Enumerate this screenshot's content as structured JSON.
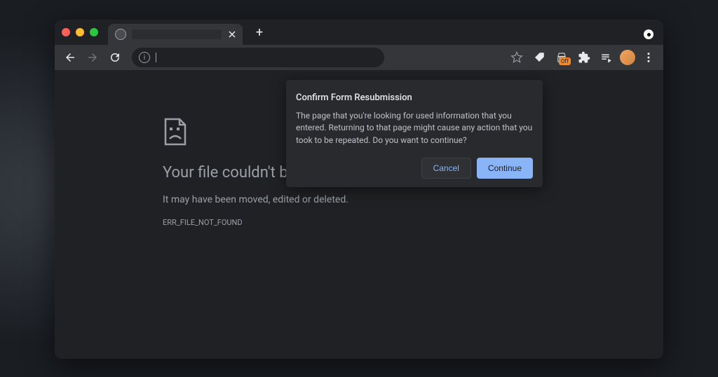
{
  "tabStrip": {
    "newTab": "+"
  },
  "toolbar": {
    "extensionBadge": "Off"
  },
  "errorPage": {
    "title": "Your file couldn't be accessed",
    "subtitle": "It may have been moved, edited or deleted.",
    "code": "ERR_FILE_NOT_FOUND"
  },
  "dialog": {
    "title": "Confirm Form Resubmission",
    "body": "The page that you're looking for used information that you entered. Returning to that page might cause any action that you took to be repeated. Do you want to continue?",
    "cancel": "Cancel",
    "continue": "Continue"
  }
}
